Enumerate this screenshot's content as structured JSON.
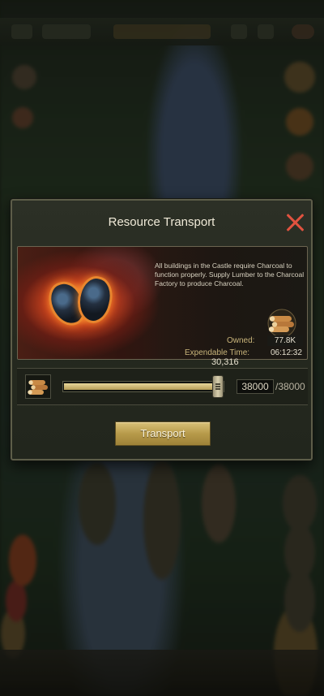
{
  "dialog": {
    "title": "Resource Transport",
    "description": "All buildings in the Castle require Charcoal to function properly. Supply Lumber to the Charcoal Factory to produce Charcoal.",
    "owned_label": "Owned:",
    "owned_value": "77.8K",
    "expendable_label": "Expendable Time:",
    "expendable_value": "06:12:32",
    "slider": {
      "current_label": "30,316",
      "input_value": "38000",
      "max_label": "/38000",
      "fill_fraction": 1.0
    },
    "transport_label": "Transport"
  },
  "icons": {
    "close": "close-icon",
    "resource": "lumber-icon",
    "product": "charcoal-icon"
  },
  "colors": {
    "accent_gold": "#c9ad5f",
    "close_red": "#e0523f",
    "label_gold": "#c8b47a"
  }
}
